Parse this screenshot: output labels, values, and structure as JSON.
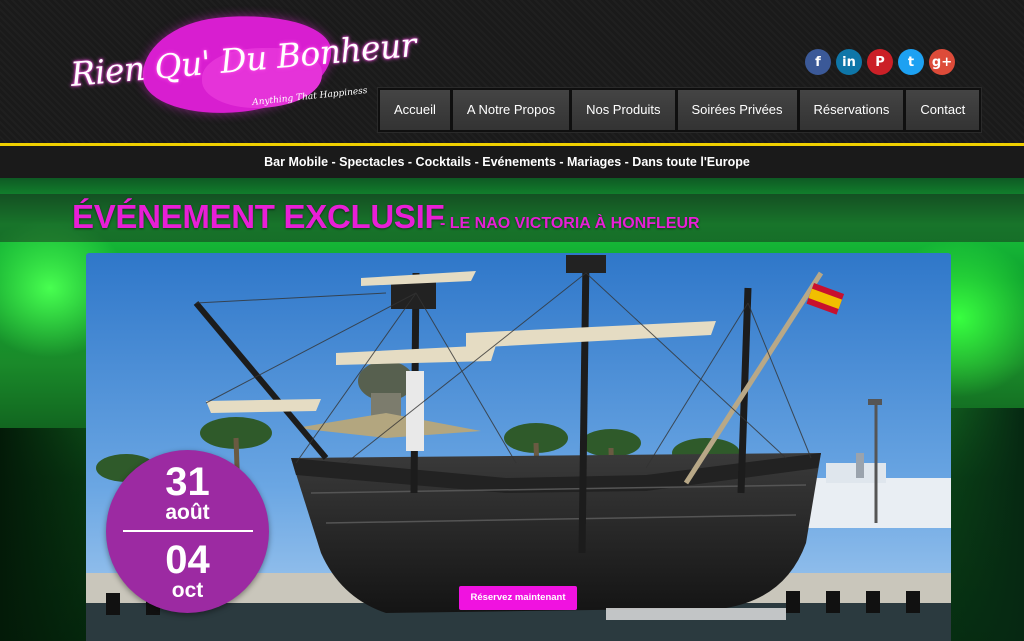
{
  "logo": {
    "name": "Rien Qu' Du Bonheur",
    "tagline": "Anything That Happiness"
  },
  "social": [
    {
      "icon": "facebook-icon",
      "glyph": "f",
      "color": "#3b5998"
    },
    {
      "icon": "linkedin-icon",
      "glyph": "in",
      "color": "#0e76a8"
    },
    {
      "icon": "pinterest-icon",
      "glyph": "P",
      "color": "#cb2027"
    },
    {
      "icon": "twitter-icon",
      "glyph": "t",
      "color": "#1da1f2"
    },
    {
      "icon": "googleplus-icon",
      "glyph": "g+",
      "color": "#dd4b39"
    }
  ],
  "nav": {
    "items": [
      {
        "label": "Accueil"
      },
      {
        "label": "A Notre Propos"
      },
      {
        "label": "Nos Produits"
      },
      {
        "label": "Soirées Privées"
      },
      {
        "label": "Réservations"
      },
      {
        "label": "Contact"
      }
    ]
  },
  "tagline": "Bar Mobile - Spectacles - Cocktails - Evénements - Mariages - Dans toute l'Europe",
  "hero": {
    "title": "ÉVÉNEMENT EXCLUSIF",
    "subtitle": "- LE NAO VICTORIA À HONFLEUR",
    "date_start_day": "31",
    "date_start_month": "août",
    "date_end_day": "04",
    "date_end_month": "oct",
    "cta_label": "Réservez maintenant"
  },
  "colors": {
    "accent": "#e81fd6",
    "nav_bg": "#3b3b3b",
    "rule": "#f0d000",
    "badge": "#9c2aa2"
  }
}
